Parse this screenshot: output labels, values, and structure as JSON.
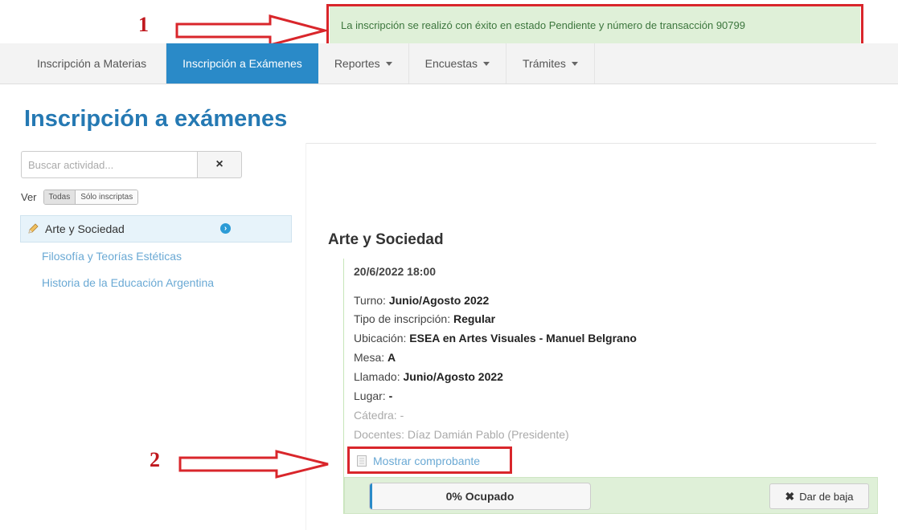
{
  "annotations": {
    "marker_1": "1",
    "marker_2": "2"
  },
  "alert": {
    "message": "La inscripción se realizó con éxito en estado Pendiente y número de transacción 90799"
  },
  "nav": {
    "items": [
      {
        "label": "Inscripción a Materias"
      },
      {
        "label": "Inscripción a Exámenes"
      },
      {
        "label": "Reportes"
      },
      {
        "label": "Encuestas"
      },
      {
        "label": "Trámites"
      }
    ]
  },
  "page": {
    "title": "Inscripción a exámenes"
  },
  "search": {
    "placeholder": "Buscar actividad...",
    "clear_icon": "×"
  },
  "filter": {
    "label": "Ver",
    "all": "Todas",
    "enrolled": "Sólo inscriptas"
  },
  "activities": [
    {
      "name": "Arte y Sociedad"
    },
    {
      "name": "Filosofía y Teorías Estéticas"
    },
    {
      "name": "Historia de la Educación Argentina"
    }
  ],
  "exam": {
    "title": "Arte y Sociedad",
    "datetime": "20/6/2022 18:00",
    "turno_label": "Turno:",
    "turno_value": "Junio/Agosto 2022",
    "tipo_label": "Tipo de inscripción:",
    "tipo_value": "Regular",
    "ubicacion_label": "Ubicación:",
    "ubicacion_value": "ESEA en Artes Visuales - Manuel Belgrano",
    "mesa_label": "Mesa:",
    "mesa_value": "A",
    "llamado_label": "Llamado:",
    "llamado_value": "Junio/Agosto 2022",
    "lugar_label": "Lugar:",
    "lugar_value": "-",
    "catedra": "Cátedra: -",
    "docentes": "Docentes: Díaz Damián Pablo (Presidente)",
    "voucher_link": "Mostrar comprobante",
    "occupancy_label": "0% Ocupado",
    "occupancy_percent": 0,
    "drop_button": "Dar de baja"
  },
  "colors": {
    "accent": "#2a8ac8",
    "title": "#2579b3",
    "success_bg": "#dff0d8",
    "annotation": "#d9262b"
  }
}
